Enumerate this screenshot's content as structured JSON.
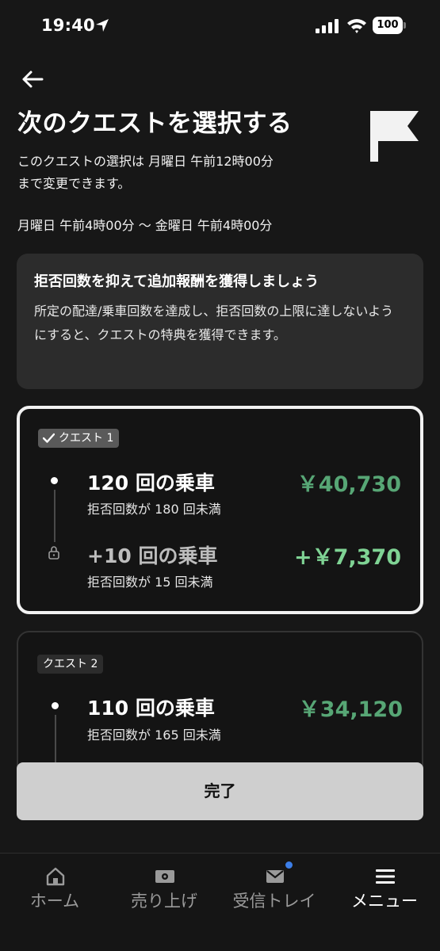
{
  "status_bar": {
    "time": "19:40",
    "battery": "100"
  },
  "header": {
    "title": "次のクエストを選択する",
    "deadline_line1": "このクエストの選択は 月曜日 午前12時00分",
    "deadline_line2": "まで変更できます。",
    "period": "月曜日 午前4時00分 〜 金曜日 午前4時00分"
  },
  "info": {
    "title": "拒否回数を抑えて追加報酬を獲得しましょう",
    "body": "所定の配達/乗車回数を達成し、拒否回数の上限に達しないようにすると、クエストの特典を獲得できます。"
  },
  "quests": [
    {
      "tag": "クエスト 1",
      "selected": true,
      "tiers": [
        {
          "label": "120 回の乗車",
          "sub": "拒否回数が 180 回未満",
          "amount": "￥40,730",
          "locked": false
        },
        {
          "label": "+10 回の乗車",
          "sub": "拒否回数が 15 回未満",
          "amount": "+￥7,370",
          "locked": true
        }
      ]
    },
    {
      "tag": "クエスト 2",
      "selected": false,
      "tiers": [
        {
          "label": "110 回の乗車",
          "sub": "拒否回数が 165 回未満",
          "amount": "￥34,120",
          "locked": false
        }
      ]
    }
  ],
  "done_button": "完了",
  "bottom_nav": [
    {
      "label": "ホーム",
      "icon": "home-icon",
      "active": false
    },
    {
      "label": "売り上げ",
      "icon": "earnings-icon",
      "active": false
    },
    {
      "label": "受信トレイ",
      "icon": "inbox-icon",
      "active": false,
      "badge": true
    },
    {
      "label": "メニュー",
      "icon": "menu-icon",
      "active": true
    }
  ],
  "colors": {
    "background": "#171717",
    "amount_green": "#57a675",
    "bonus_green": "#7fd394",
    "badge_blue": "#3c7ee8"
  }
}
